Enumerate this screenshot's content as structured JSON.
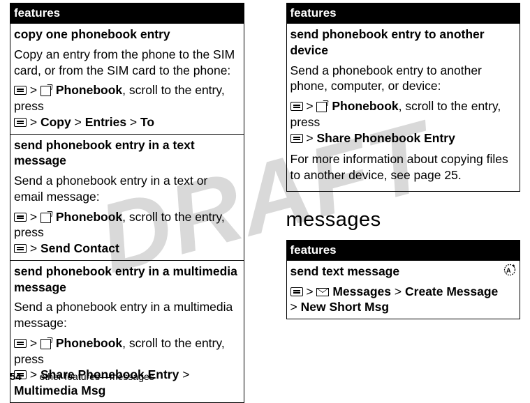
{
  "watermark": "DRAFT",
  "left": {
    "header": "features",
    "rows": [
      {
        "title": "copy one phonebook entry",
        "body": "Copy an entry from the phone to the SIM card, or from the SIM card to the phone:",
        "nav1_gt": ">",
        "nav1_pb": "Phonebook",
        "nav1_tail": ", scroll to the entry, press",
        "nav2_gt1": ">",
        "nav2_a": "Copy",
        "nav2_gt2": ">",
        "nav2_b": "Entries",
        "nav2_gt3": ">",
        "nav2_c": "To"
      },
      {
        "title": "send phonebook entry in a text message",
        "body": "Send a phonebook entry in a text or email message:",
        "nav1_gt": ">",
        "nav1_pb": "Phonebook",
        "nav1_tail": ", scroll to the entry, press",
        "nav2_gt1": ">",
        "nav2_a": "Send Contact"
      },
      {
        "title": "send phonebook entry in a multimedia message",
        "body": "Send a phonebook entry in a multimedia message:",
        "nav1_gt": ">",
        "nav1_pb": "Phonebook",
        "nav1_tail": ", scroll to the entry, press",
        "nav2_gt1": ">",
        "nav2_a": "Share Phonebook Entry",
        "nav2_gt2": ">",
        "nav2_b": "Multimedia Msg"
      }
    ]
  },
  "right_top": {
    "header": "features",
    "row": {
      "title": "send phonebook entry to another device",
      "body": "Send a phonebook entry to another phone, computer, or device:",
      "nav1_gt": ">",
      "nav1_pb": "Phonebook",
      "nav1_tail": ", scroll to the entry, press",
      "nav2_gt1": ">",
      "nav2_a": "Share Phonebook Entry",
      "after": "For more information about copying files to another device, see page 25."
    }
  },
  "section_heading": "messages",
  "right_bottom": {
    "header": "features",
    "row": {
      "title": "send text message",
      "nav1_gt": ">",
      "nav1_msg": "Messages",
      "nav1_gt2": ">",
      "nav1_b": "Create Message",
      "nav2_gt": ">",
      "nav2_a": "New Short Msg"
    }
  },
  "footer": {
    "page": "54",
    "text": "other features—messages"
  }
}
